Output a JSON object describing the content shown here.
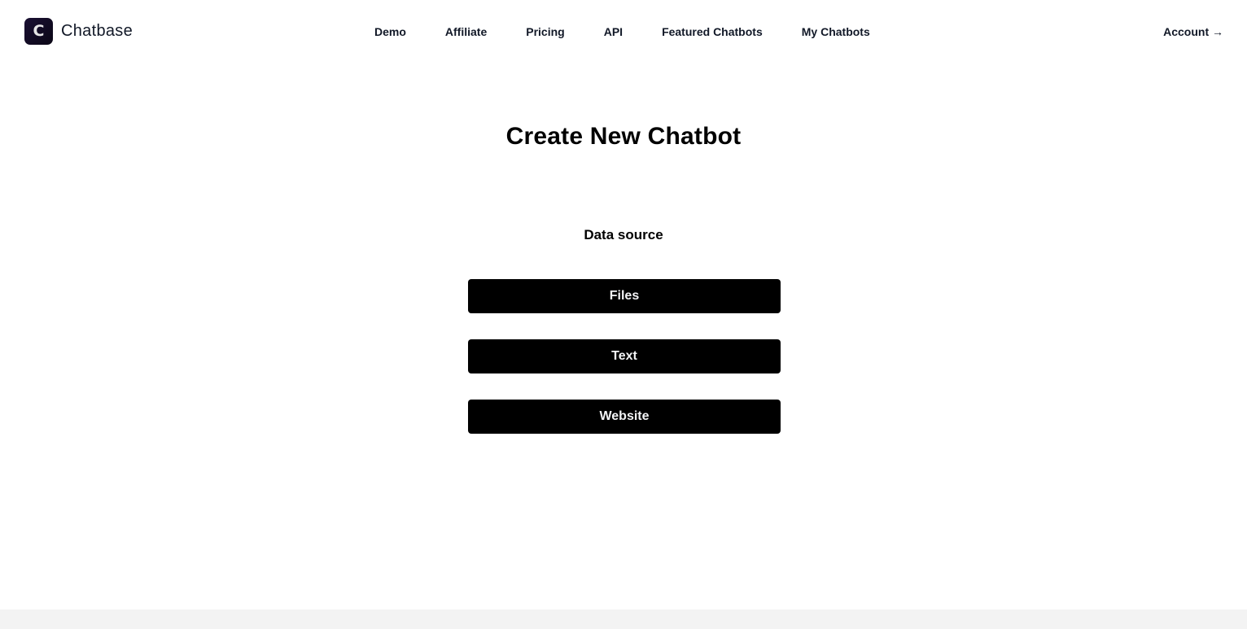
{
  "header": {
    "brand": {
      "name": "Chatbase",
      "logo_letter": "C",
      "icon": "chatbase-logo-icon"
    },
    "nav": [
      {
        "label": "Demo"
      },
      {
        "label": "Affiliate"
      },
      {
        "label": "Pricing"
      },
      {
        "label": "API"
      },
      {
        "label": "Featured Chatbots"
      },
      {
        "label": "My Chatbots"
      }
    ],
    "account": {
      "label": "Account →"
    }
  },
  "main": {
    "title": "Create New Chatbot",
    "section_label": "Data source",
    "sources": [
      {
        "label": "Files"
      },
      {
        "label": "Text"
      },
      {
        "label": "Website"
      }
    ]
  },
  "colors": {
    "button_bg": "#000000",
    "button_text": "#f3f4f6",
    "footer_bg": "#f3f3f3",
    "logo_bg": "#140c26"
  }
}
